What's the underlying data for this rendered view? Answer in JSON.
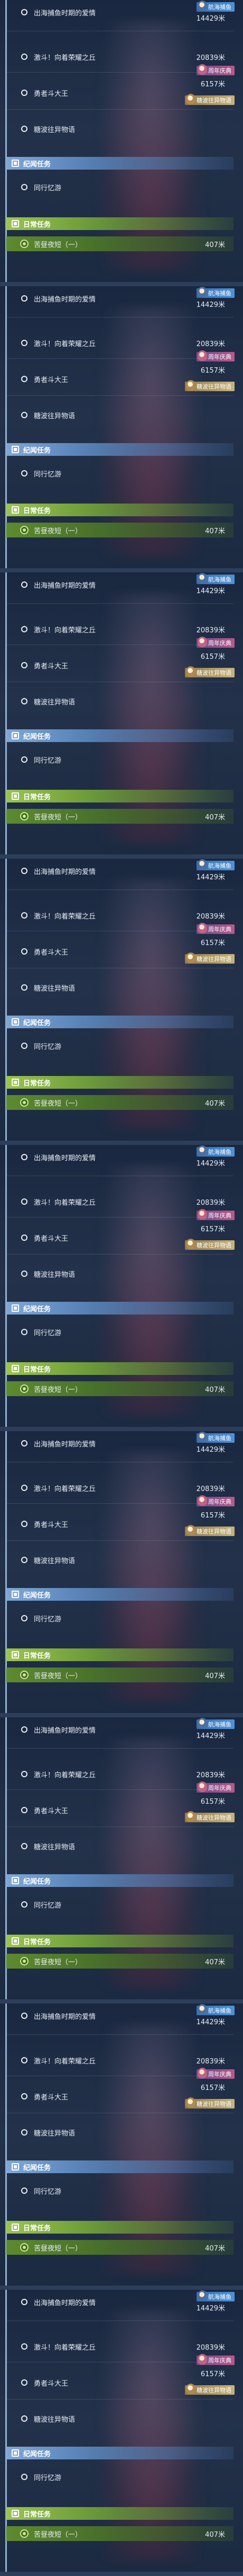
{
  "quests": {
    "item1": {
      "label": "出海捕鱼时期的爱情",
      "distance": "14429米",
      "badge": "航海捕鱼"
    },
    "item2": {
      "label": "激斗！向着荣耀之丘",
      "distance": "20839米",
      "badge": "周年庆典"
    },
    "item3": {
      "label": "勇者斗大王",
      "distance": "6157米",
      "badge": ""
    },
    "item4": {
      "label": "糖波往异物语",
      "badge": "糖波往异物语"
    },
    "section_legend": {
      "label": "纪闻任务"
    },
    "item5": {
      "label": "同行忆游"
    },
    "section_daily": {
      "label": "日常任务"
    },
    "item6": {
      "label": "苦昼夜短（一）",
      "distance": "407米"
    }
  },
  "colors": {
    "background": "#1d2a3f",
    "legend_header": "#7fa8d6",
    "daily_header": "#9cc54f",
    "highlight_row": "#5d8a2e"
  },
  "icons": {
    "radio": "radio-unselected-icon",
    "section": "quest-section-icon",
    "tracked": "tracking-target-icon"
  }
}
